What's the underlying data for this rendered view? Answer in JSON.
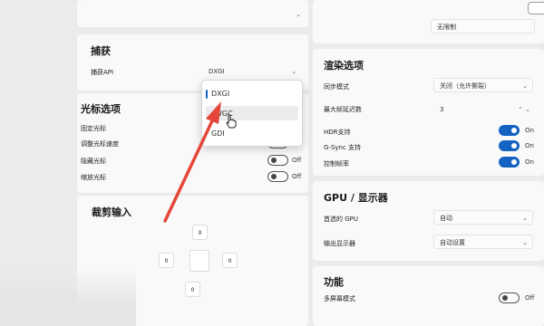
{
  "capture": {
    "title": "捕获",
    "api_label": "捕获API",
    "api_value": "DXGI",
    "dropdown_options": [
      "DXGI",
      "WGC",
      "GDI"
    ]
  },
  "cursor": {
    "title": "光标选项",
    "items": [
      {
        "label": "固定光标"
      },
      {
        "label": "调整光标速度",
        "state": "Off"
      },
      {
        "label": "隐藏光标",
        "state": "Off"
      },
      {
        "label": "缩放光标",
        "state": "Off"
      }
    ]
  },
  "crop": {
    "title": "裁剪输入",
    "values": {
      "top": "0",
      "left": "0",
      "right": "0",
      "bottom": "0"
    }
  },
  "render": {
    "top_select_value": "无限制",
    "title": "渲染选项",
    "vsync_label": "同步模式",
    "vsync_value": "关闭（允许撕裂）",
    "max_frames_label": "最大帧延迟数",
    "max_frames_value": "3",
    "hdr_label": "HDR支持",
    "hdr_state": "On",
    "gsync_label": "G-Sync 支持",
    "gsync_state": "On",
    "frame_rate_label": "控制帧率",
    "frame_rate_state": "On"
  },
  "gpu": {
    "title": "GPU / 显示器",
    "gpu_label": "首选的 GPU",
    "gpu_value": "自动",
    "monitor_label": "输出显示器",
    "monitor_value": "自动设置"
  },
  "features": {
    "title": "功能",
    "multi_monitor_label": "多屏幕模式",
    "multi_monitor_state": "Off"
  },
  "colors": {
    "accent": "#1463c2",
    "arrow": "#e4473a"
  }
}
